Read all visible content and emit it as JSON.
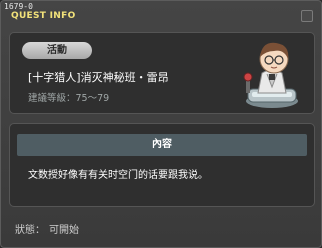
{
  "window": {
    "id_label": "1679-0",
    "title": "QUEST INFO"
  },
  "quest": {
    "category_badge": "活動",
    "name": "[十字猎人]消灭神秘班・雷昂",
    "level_label": "建議等級：",
    "level_range": "75～79"
  },
  "content": {
    "header": "內容",
    "description": "文数授好像有有关时空门的话要跟我说。"
  },
  "status": {
    "label": "狀態：",
    "value": "可開始"
  },
  "colors": {
    "title_yellow": "#f2e27a",
    "header_bg": "#4f5d63",
    "panel_bg": "#2f2f2f"
  }
}
